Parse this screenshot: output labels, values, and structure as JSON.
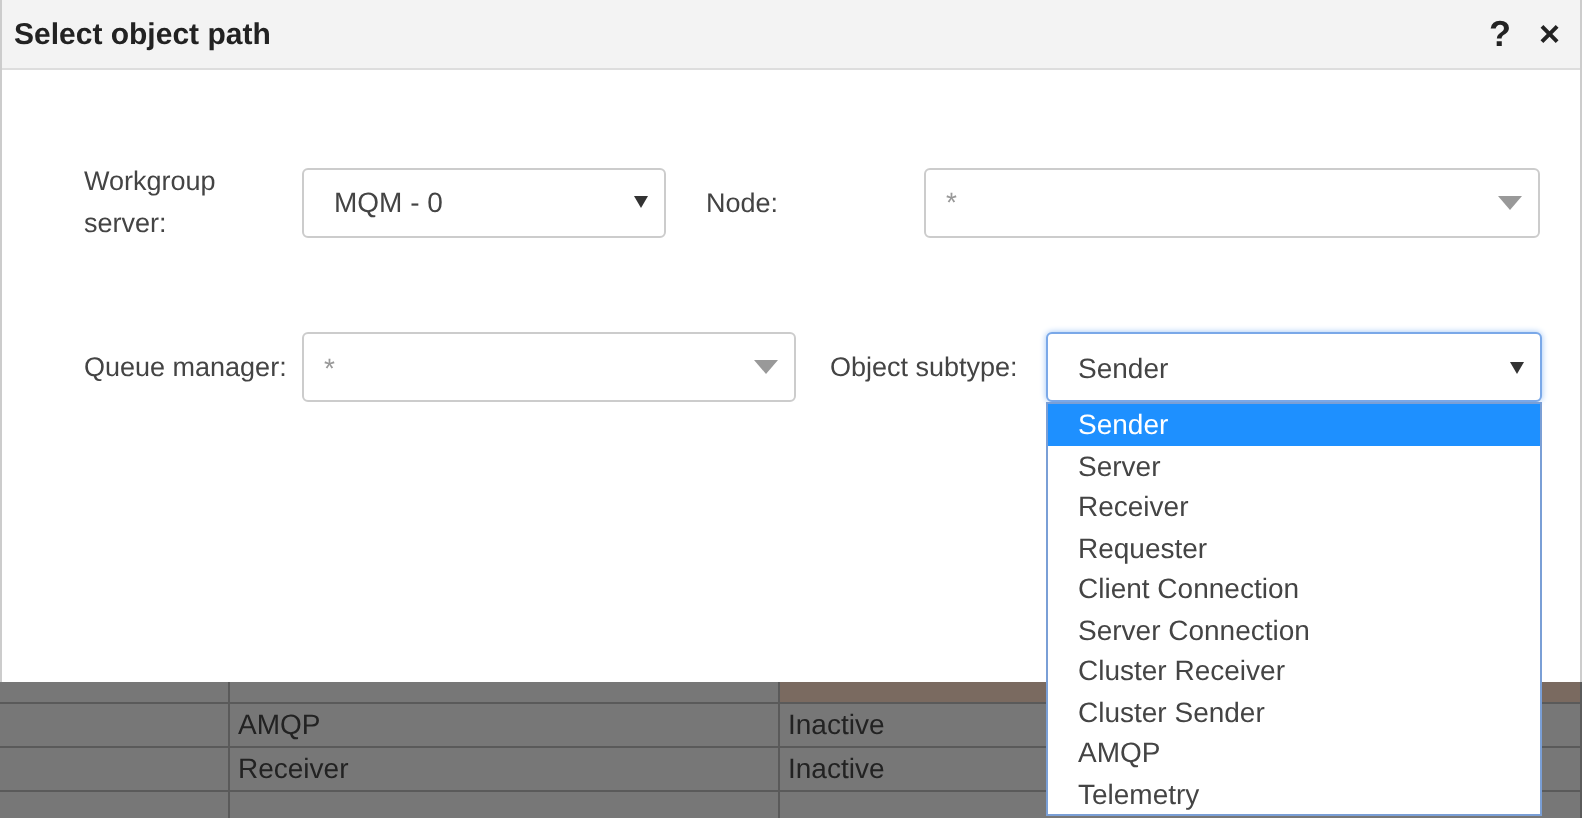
{
  "dialog": {
    "title": "Select object path",
    "help": "?",
    "close": "×"
  },
  "fields": [
    {
      "label": "Workgroup server:",
      "kind": "native",
      "value": "MQM - 0",
      "focused": false
    },
    {
      "label": "Node:",
      "kind": "combo",
      "placeholder": "*",
      "focused": false
    },
    {
      "label": "Queue manager:",
      "kind": "combo",
      "placeholder": "*",
      "focused": false
    },
    {
      "label": "Object subtype:",
      "kind": "native",
      "value": "Sender",
      "focused": true
    }
  ],
  "subtype_options": [
    {
      "label": "Sender",
      "selected": true
    },
    {
      "label": "Server",
      "selected": false
    },
    {
      "label": "Receiver",
      "selected": false
    },
    {
      "label": "Requester",
      "selected": false
    },
    {
      "label": "Client Connection",
      "selected": false
    },
    {
      "label": "Server Connection",
      "selected": false
    },
    {
      "label": "Cluster Receiver",
      "selected": false
    },
    {
      "label": "Cluster Sender",
      "selected": false
    },
    {
      "label": "AMQP",
      "selected": false
    },
    {
      "label": "Telemetry",
      "selected": false
    }
  ],
  "background_table": {
    "rows": [
      {
        "warning": true
      },
      {
        "type": "AMQP",
        "status": "Inactive",
        "warning": false
      },
      {
        "type": "Receiver",
        "status": "Inactive",
        "warning": false
      },
      {
        "warning": false
      }
    ]
  }
}
